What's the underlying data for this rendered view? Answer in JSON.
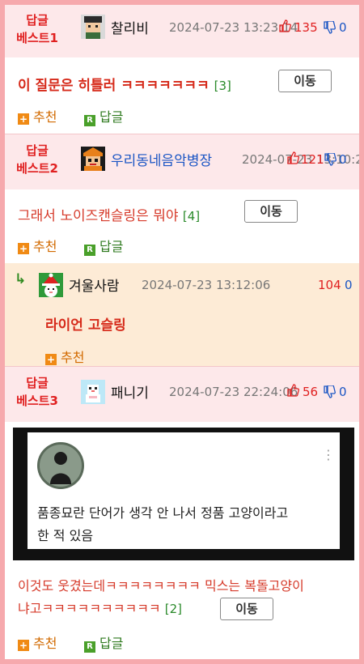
{
  "best_label_top": "답글",
  "posts": [
    {
      "best_label": "베스트1",
      "nickname": "찰리비",
      "date": "2024-07-23 13:23:14",
      "likes": "135",
      "dislikes": "0",
      "content": "이 질문은 히틀러 ㅋㅋㅋㅋㅋㅋㅋ",
      "reply_count": "[3]",
      "move_label": "이동",
      "recommend_label": "추천",
      "reply_label": "답글"
    },
    {
      "best_label": "베스트2",
      "nickname": "우리동네음악병장",
      "date": "2024-07-23 13:10:2",
      "likes": "121",
      "dislikes": "0",
      "content": "그래서 노이즈캔슬링은 뭐야",
      "reply_count": "[4]",
      "move_label": "이동",
      "recommend_label": "추천",
      "reply_label": "답글"
    },
    {
      "best_label": "베스트3",
      "nickname": "패니기",
      "date": "2024-07-23 22:24:06",
      "likes": "56",
      "dislikes": "0",
      "content_line1": "이것도 웃겼는데ㅋㅋㅋㅋㅋㅋㅋㅋ 믹스는 복돌고양이",
      "content_line2": "냐고ㅋㅋㅋㅋㅋㅋㅋㅋㅋㅋ",
      "reply_count": "[2]",
      "move_label": "이동",
      "recommend_label": "추천",
      "reply_label": "답글",
      "embed_text_line1": "품종묘란 단어가 생각 안 나서 정품 고양이라고",
      "embed_text_line2": "한 적 있음",
      "embed_menu": "⋮"
    }
  ],
  "reply": {
    "arrow": "↳",
    "nickname": "겨울사람",
    "date": "2024-07-23 13:12:06",
    "likes": "104",
    "dislikes": "0",
    "content": "라이언 고슬링",
    "recommend_label": "추천"
  },
  "icons": {
    "thumb_up": "👍",
    "thumb_down": "👎",
    "plus": "+",
    "reply_badge": "R"
  },
  "colors": {
    "frame_border": "#f6a9ad",
    "best_bg": "#fde8ea",
    "reply_bg": "#fdebd6",
    "accent_red": "#e02020",
    "accent_blue": "#1a55c4"
  }
}
